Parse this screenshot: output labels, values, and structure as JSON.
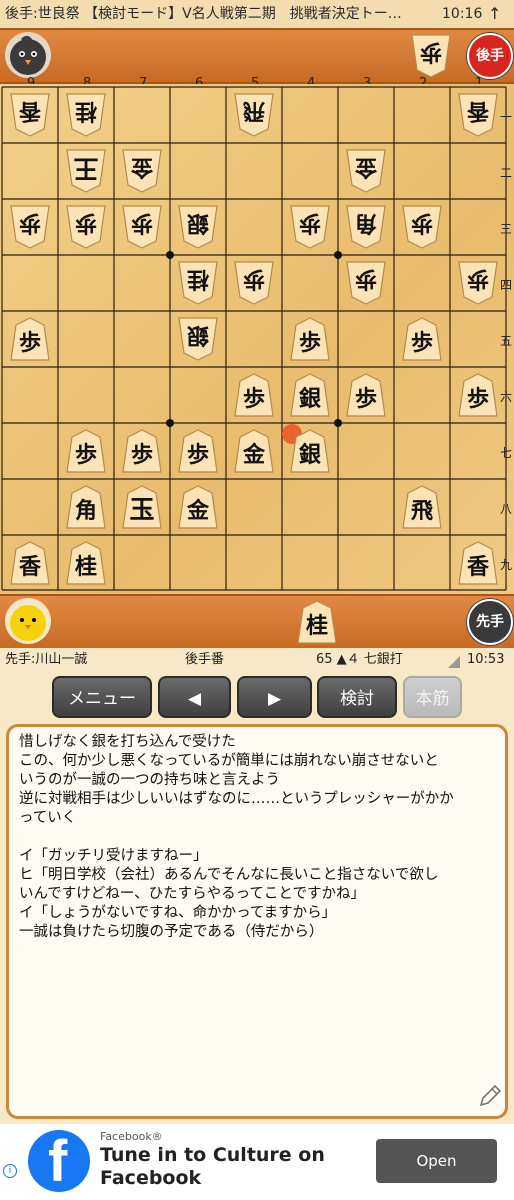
{
  "status_bar": {
    "title": "後手:世良祭 【検討モード】V名人戦第二期　挑戦者決定トー…",
    "time": "10:16",
    "arrow": "↑"
  },
  "gote_player": {
    "badge": "後手",
    "hand_piece": "歩",
    "avatar_icon": "black-bird-icon"
  },
  "sente_player": {
    "badge": "先手",
    "hand_piece": "桂",
    "avatar_icon": "yellow-chick-icon"
  },
  "board": {
    "file_labels": [
      "9",
      "8",
      "7",
      "6",
      "5",
      "4",
      "3",
      "2",
      "1"
    ],
    "rank_labels": [
      "一",
      "二",
      "三",
      "四",
      "五",
      "六",
      "七",
      "八",
      "九"
    ]
  },
  "info": {
    "sente_name": "先手:川山一誠",
    "turn": "後手番",
    "move": "65 ▲４ 七銀打",
    "time": "10:53"
  },
  "buttons": {
    "menu": "メニュー",
    "prev": "◀",
    "next": "▶",
    "analyze": "検討",
    "mainline": "本筋"
  },
  "comment": [
    "惜しげなく銀を打ち込んで受けた",
    "この、何か少し悪くなっているが簡単には崩れない崩させないと",
    "いうのが一誠の一つの持ち味と言えよう",
    "逆に対戦相手は少しいいはずなのに……というプレッシャーがかか",
    "っていく",
    "",
    "イ「ガッチリ受けますねー」",
    "ヒ「明日学校（会社）あるんでそんなに長いこと指さないで欲し",
    "いんですけどねー、ひたすらやるってことですかね」",
    "イ「しょうがないですね、命かかってますから」",
    "一誠は負けたら切腹の予定である（侍だから）"
  ],
  "ad": {
    "advertiser": "Facebook®",
    "headline": "Tune in to Culture on Facebook",
    "cta": "Open"
  },
  "colors": {
    "gote_badge": "#d8261e",
    "sente_badge": "#3a3a3a",
    "last_move_marker": "#e8632d",
    "comment_border": "#c9893d"
  }
}
